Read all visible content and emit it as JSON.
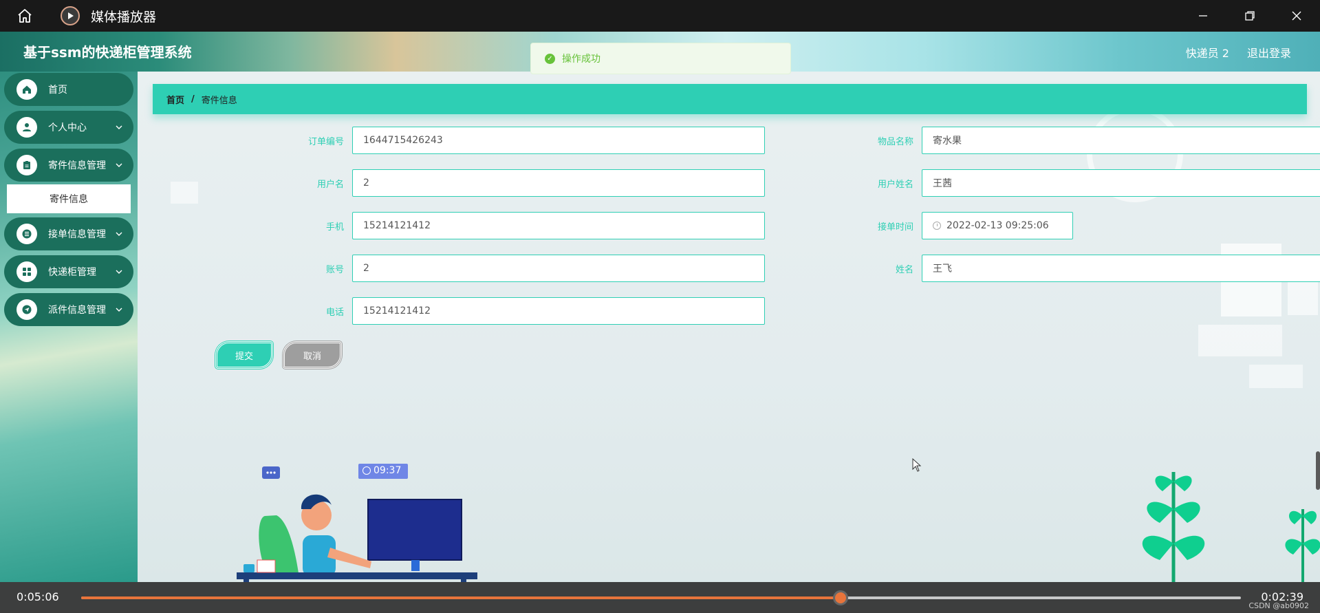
{
  "player": {
    "title": "媒体播放器",
    "time_current": "0:05:06",
    "time_total": "0:02:39",
    "progress": 0.655,
    "watermark": "CSDN @ab0902"
  },
  "app": {
    "title": "基于ssm的快递柜管理系统",
    "user": "快递员 2",
    "logout": "退出登录"
  },
  "toast": {
    "text": "操作成功"
  },
  "sidebar": {
    "items": [
      {
        "label": "首页",
        "icon": "home-icon"
      },
      {
        "label": "个人中心",
        "icon": "user-icon"
      },
      {
        "label": "寄件信息管理",
        "icon": "clipboard-icon"
      },
      {
        "label": "接单信息管理",
        "icon": "list-icon"
      },
      {
        "label": "快递柜管理",
        "icon": "grid-icon"
      },
      {
        "label": "派件信息管理",
        "icon": "send-icon"
      }
    ],
    "submenu": "寄件信息"
  },
  "breadcrumb": {
    "home": "首页",
    "sep": "/",
    "current": "寄件信息"
  },
  "form": {
    "order_no": {
      "label": "订单编号",
      "value": "1644715426243"
    },
    "username": {
      "label": "用户名",
      "value": "2"
    },
    "phone": {
      "label": "手机",
      "value": "15214121412"
    },
    "account": {
      "label": "账号",
      "value": "2"
    },
    "tel": {
      "label": "电话",
      "value": "15214121412"
    },
    "item_name": {
      "label": "物品名称",
      "value": "寄水果"
    },
    "user_fullname": {
      "label": "用户姓名",
      "value": "王茜"
    },
    "order_time": {
      "label": "接单时间",
      "value": "2022-02-13 09:25:06"
    },
    "name": {
      "label": "姓名",
      "value": "王飞"
    }
  },
  "buttons": {
    "submit": "提交",
    "cancel": "取消"
  },
  "illustration": {
    "clock_text": "09:37"
  },
  "colors": {
    "accent": "#2ecfb4",
    "sidebar_item": "#1b6f5c",
    "success": "#67c23a",
    "progress": "#e8743b"
  }
}
